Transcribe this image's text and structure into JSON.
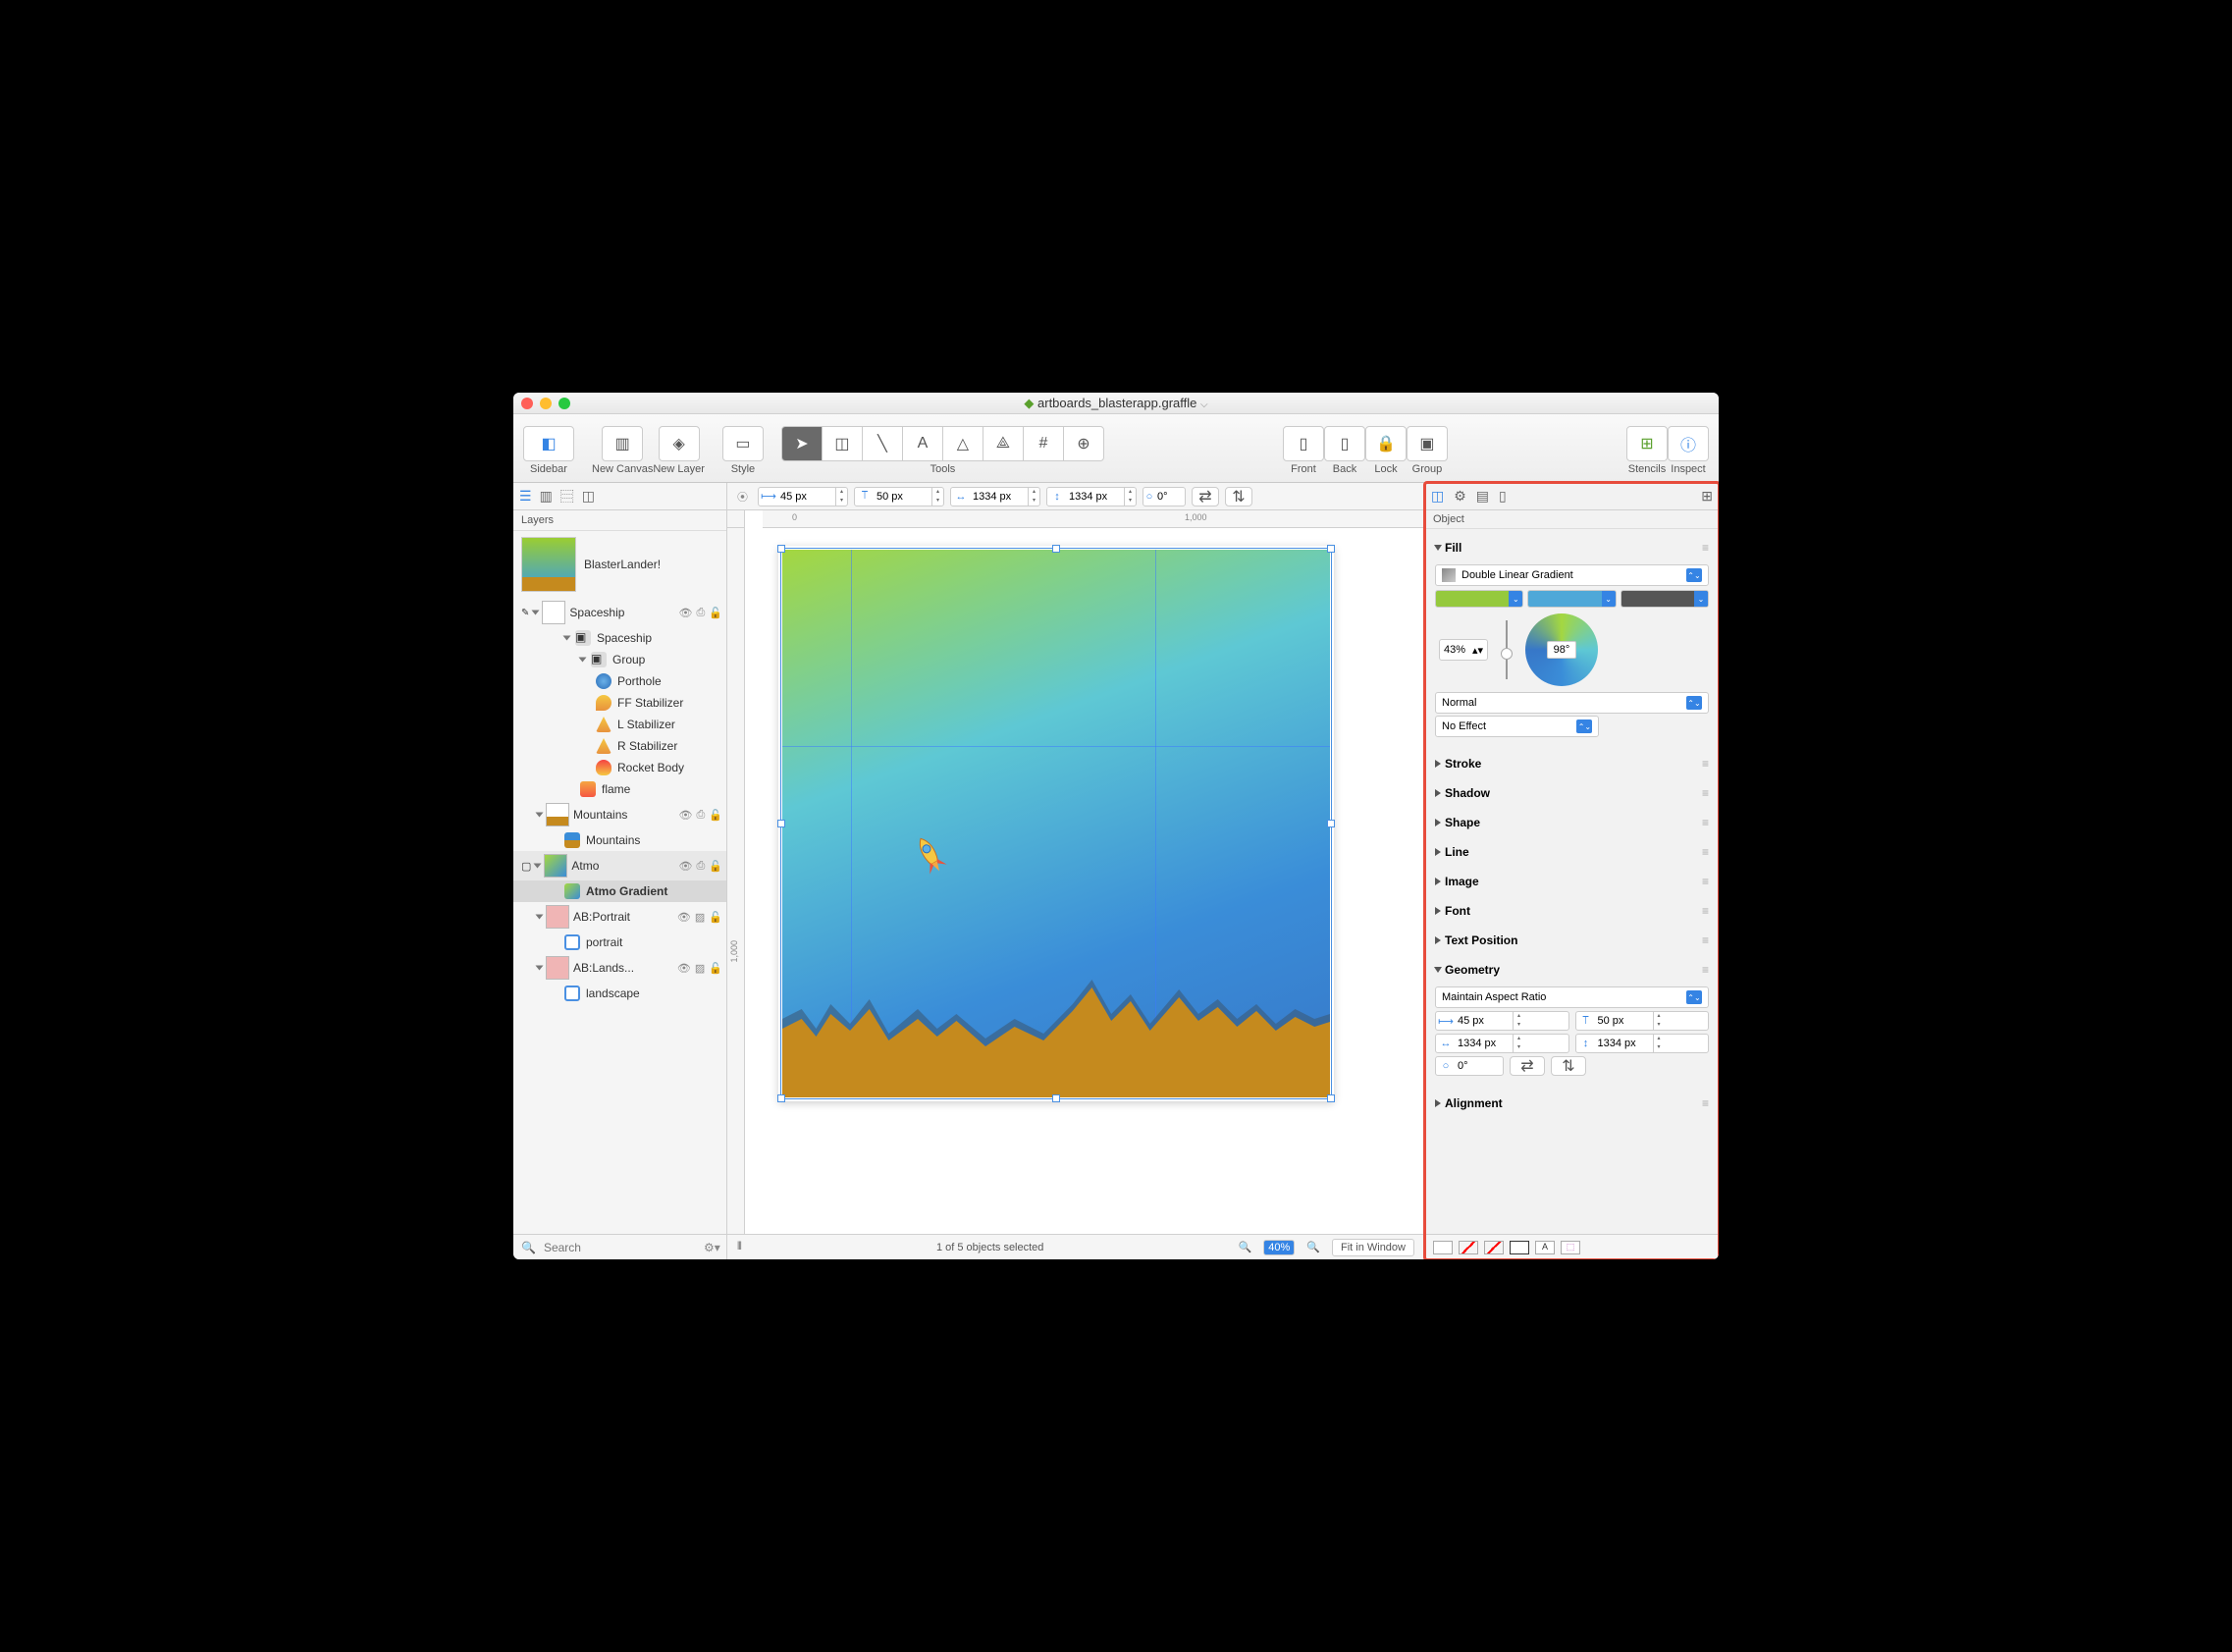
{
  "title": "artboards_blasterapp.graffle",
  "toolbar": {
    "sidebar": "Sidebar",
    "new_canvas": "New Canvas",
    "new_layer": "New Layer",
    "style": "Style",
    "tools": "Tools",
    "front": "Front",
    "back": "Back",
    "lock": "Lock",
    "group": "Group",
    "stencils": "Stencils",
    "inspect": "Inspect"
  },
  "dimbar": {
    "x": "45 px",
    "y": "50 px",
    "w": "1334 px",
    "h": "1334 px",
    "rot": "0°"
  },
  "ruler": {
    "r0": "0",
    "r1000": "1,000",
    "rv1000": "1,000"
  },
  "sidebar": {
    "header": "Layers",
    "canvas": "BlasterLander!",
    "layers": {
      "spaceship": "Spaceship",
      "spaceship_grp": "Spaceship",
      "group": "Group",
      "porthole": "Porthole",
      "ff_stab": "FF Stabilizer",
      "l_stab": "L Stabilizer",
      "r_stab": "R Stabilizer",
      "body": "Rocket Body",
      "flame": "flame",
      "mountains": "Mountains",
      "mountains_obj": "Mountains",
      "atmo": "Atmo",
      "atmo_grad": "Atmo Gradient",
      "ab_portrait": "AB:Portrait",
      "portrait": "portrait",
      "ab_lands": "AB:Lands...",
      "landscape": "landscape"
    },
    "search_ph": "Search"
  },
  "status": {
    "selection": "1 of 5 objects selected",
    "zoom": "40%",
    "fit": "Fit in Window"
  },
  "inspector": {
    "header": "Object",
    "fill": {
      "title": "Fill",
      "type": "Double Linear Gradient",
      "pos": "43%",
      "angle": "98°",
      "blend": "Normal",
      "effect": "No Effect"
    },
    "sections": {
      "stroke": "Stroke",
      "shadow": "Shadow",
      "shape": "Shape",
      "line": "Line",
      "image": "Image",
      "font": "Font",
      "text_position": "Text Position",
      "geometry": "Geometry",
      "alignment": "Alignment"
    },
    "geometry": {
      "aspect": "Maintain Aspect Ratio",
      "x": "45 px",
      "y": "50 px",
      "w": "1334 px",
      "h": "1334 px",
      "rot": "0°"
    }
  }
}
